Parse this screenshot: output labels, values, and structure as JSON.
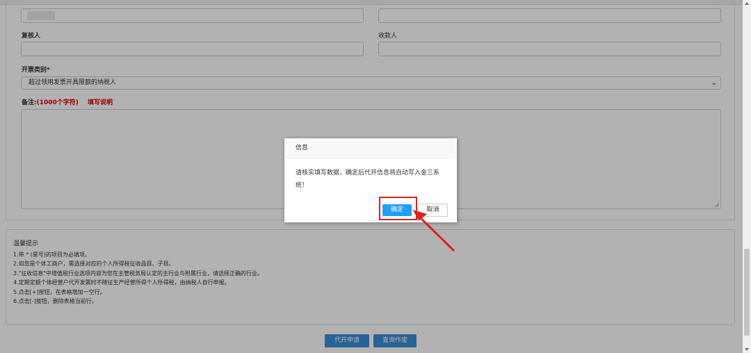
{
  "form": {
    "top_left_value": "",
    "reviewer_label": "复核人",
    "payee_label": "收款人",
    "invoice_type_label": "开票类别",
    "required_mark": "*",
    "invoice_type_selected": "超过领用发票开具限额的纳税人",
    "remarks_label": "备注:",
    "remarks_limit": "(1000个字符)",
    "remarks_help_link": "填写说明"
  },
  "tips": {
    "title": "温馨提示",
    "lines": [
      "1.带 * (星号)的项目为必填项。",
      "2.如您是个体工商户，需选择对应的个人所得税征收品目、子目。",
      "3.\"征收信息\"中增值税行业选项内容为您在主管税务局认定的主行业与附属行业，请选择正确的行业。",
      "4.定期定额个体经营户代开发票时不随征生产经营所得个人所得税，由纳税人自行申报。",
      "5.点击[+]按钮，在表格增加一空行。",
      "6.点击[-]按钮，删除表格当前行。"
    ]
  },
  "actions": {
    "apply_label": "代开申请",
    "query_void_label": "查询作废"
  },
  "dialog": {
    "title": "信息",
    "message": "请核实填写数据，确定后代开信息将自动写入金三系统！",
    "ok_label": "确定",
    "cancel_label": "取消"
  },
  "colors": {
    "primary_button": "#1e9fff",
    "page_button": "#3c8dd6",
    "required": "#dd0000",
    "highlight": "#e02020"
  }
}
